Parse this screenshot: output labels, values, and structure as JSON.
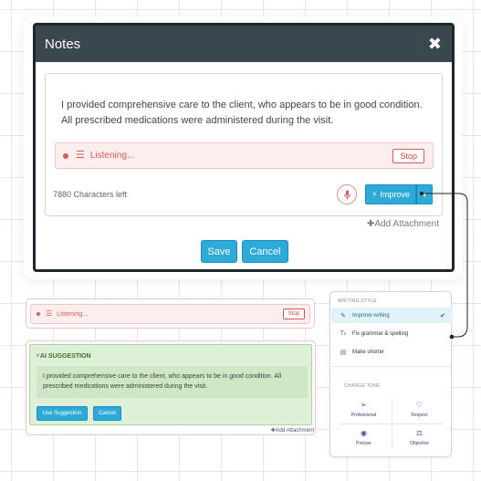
{
  "modal": {
    "title": "Notes",
    "body_text": "I provided comprehensive care to the client, who appears to be in good condition. All prescribed medications were administered during the visit.",
    "listening_text": "Listening...",
    "stop_label": "Stop",
    "char_count": "7880 Characters left",
    "improve_label": "Improve",
    "add_attachment": "Add Attachment",
    "save_label": "Save",
    "cancel_label": "Cancel"
  },
  "listen_panel": {
    "listening_text": "Listening...",
    "stop_label": "Stop"
  },
  "ai_panel": {
    "title": "AI SUGGESTION",
    "suggestion_text": "I provided comprehensive care to the client, who appears to be in good condition. All prescribed medications were administered during the visit.",
    "use_label": "Use Suggestion",
    "cancel_label": "Cancel",
    "add_attachment": "Add Attachment"
  },
  "menu": {
    "writing_style_label": "WRITING STYLE",
    "items": [
      {
        "label": "Improve writing",
        "icon": "pencil-icon",
        "active": true
      },
      {
        "label": "Fix grammar & spelling",
        "icon": "text-format-icon",
        "active": false
      },
      {
        "label": "Make shorter",
        "icon": "shorten-icon",
        "active": false
      }
    ],
    "change_tone_label": "CHANGE TONE",
    "tones": [
      {
        "label": "Professional",
        "icon": "paper-plane-icon"
      },
      {
        "label": "Respect",
        "icon": "heart-icon"
      },
      {
        "label": "Precise",
        "icon": "target-icon"
      },
      {
        "label": "Objective",
        "icon": "scale-icon"
      }
    ]
  },
  "colors": {
    "header": "#3a474f",
    "accent": "#2eaad8",
    "danger": "#d25a5a",
    "suggestion_bg": "#dff0d8"
  }
}
